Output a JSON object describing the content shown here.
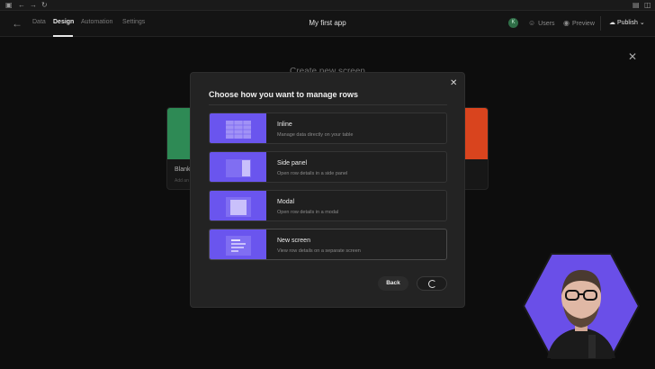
{
  "header": {
    "tabs": [
      {
        "label": "Data"
      },
      {
        "label": "Design",
        "active": true
      },
      {
        "label": "Automation"
      },
      {
        "label": "Settings"
      }
    ],
    "app_title": "My first app",
    "avatar_initial": "K",
    "users_label": "Users",
    "preview_label": "Preview",
    "publish_label": "Publish"
  },
  "background": {
    "title": "Create new screen",
    "cards": [
      {
        "label": "Blank",
        "sub": "Add an"
      }
    ],
    "accent_left": "#2e8a55",
    "accent_right": "#d9441e"
  },
  "modal": {
    "title": "Choose how you want to manage rows",
    "options": [
      {
        "name": "Inline",
        "description": "Manage data directly on your table"
      },
      {
        "name": "Side panel",
        "description": "Open row details in a side panel"
      },
      {
        "name": "Modal",
        "description": "Open row details in a modal"
      },
      {
        "name": "New screen",
        "description": "View row details on a separate screen"
      }
    ],
    "back_label": "Back",
    "accent": "#6a55ee"
  }
}
